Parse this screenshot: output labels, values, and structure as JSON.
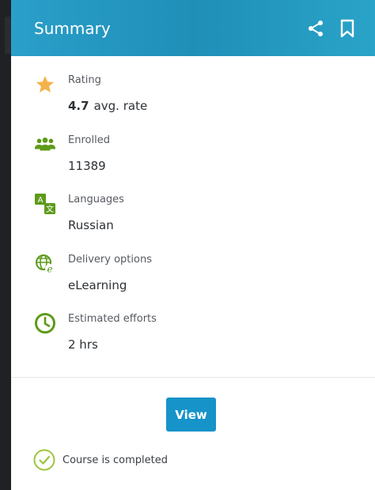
{
  "colors": {
    "header": "#1f8fb8",
    "accent": "#1693c9",
    "icon_green": "#5e9a1a",
    "star": "#f4b34a",
    "complete": "#9bc53d"
  },
  "card": {
    "title": "Summary",
    "actions": [
      {
        "icon": "share-icon"
      },
      {
        "icon": "bookmark-icon"
      }
    ]
  },
  "info": [
    {
      "icon": "star-icon",
      "label": "Rating",
      "value_number": "4.7",
      "value": "avg. rate"
    },
    {
      "icon": "users-icon",
      "label": "Enrolled",
      "value": "11389"
    },
    {
      "icon": "translate-icon",
      "label": "Languages",
      "value": "Russian"
    },
    {
      "icon": "globe-elearning-icon",
      "label": "Delivery options",
      "value": "eLearning"
    },
    {
      "icon": "clock-icon",
      "label": "Estimated efforts",
      "value": "2 hrs"
    }
  ],
  "view_button": {
    "label": "View"
  },
  "status": {
    "icon": "check-circle-icon",
    "text": "Course is completed"
  }
}
